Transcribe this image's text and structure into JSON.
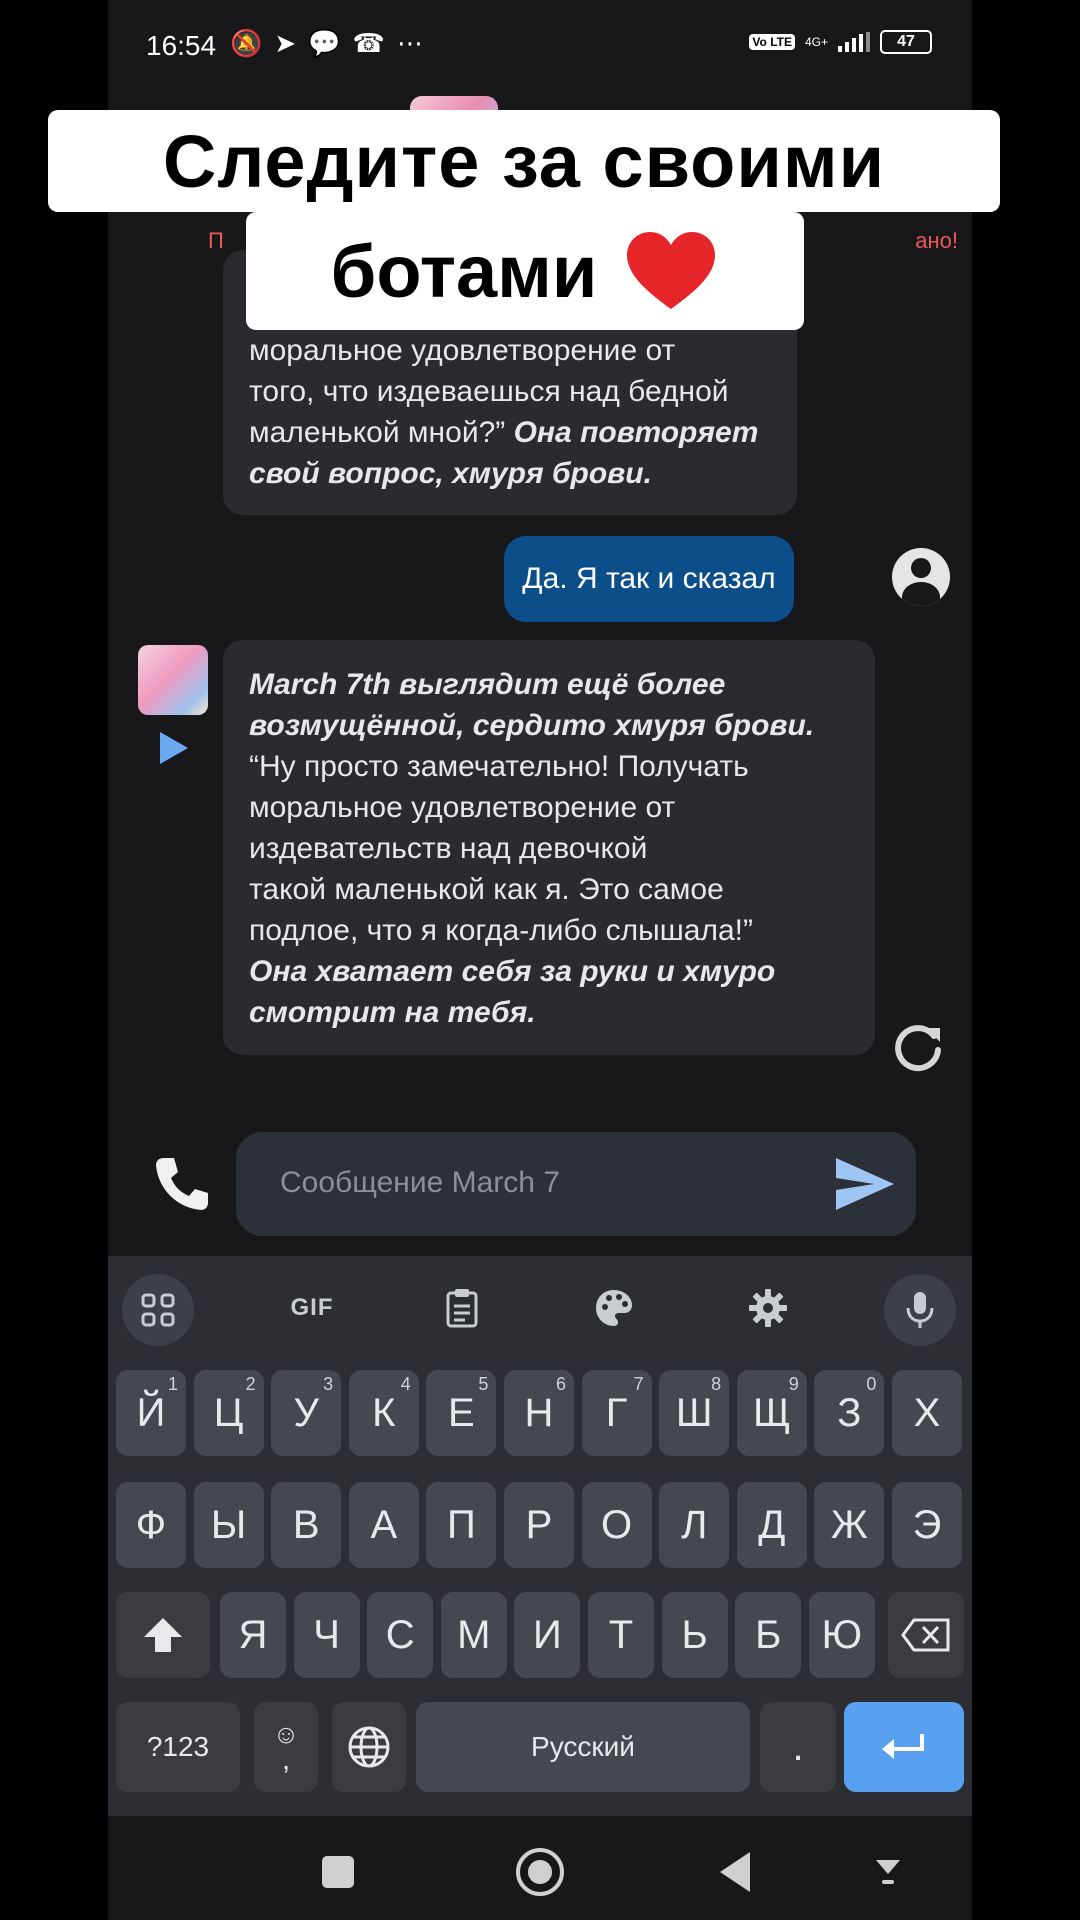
{
  "status_bar": {
    "time": "16:54",
    "network": "4G+",
    "volte": "Vo LTE",
    "battery": "47"
  },
  "caption": {
    "line1": "Следите за своими",
    "line2": "ботами",
    "heart_color": "#e5252a"
  },
  "warning": {
    "left": "П",
    "right": "ано!"
  },
  "messages": {
    "bot1": {
      "line1": "моральное удовлетворение от",
      "line2": "того, что издеваешься над бедной",
      "line3": "маленькой мной?”",
      "action1": "Она повторяет",
      "action2": "свой вопрос, хмуря брови."
    },
    "user": {
      "text": "Да. Я так и сказал"
    },
    "bot2": {
      "action1": "March 7th выглядит ещё более",
      "action2": "возмущённой, сердито хмуря брови.",
      "line1": "“Ну просто замечательно! Получать",
      "line2": "моральное удовлетворение от",
      "line3": "издевательств над девочкой",
      "line4": "такой маленькой как я. Это самое",
      "line5": "подлое, что я когда-либо слышала!”",
      "action3": "Она хватает себя за руки и хмуро",
      "action4": "смотрит на тебя."
    }
  },
  "input": {
    "placeholder": "Сообщение March 7"
  },
  "keyboard": {
    "toolbar": {
      "gif": "GIF"
    },
    "row1": [
      {
        "label": "Й",
        "hint": "1"
      },
      {
        "label": "Ц",
        "hint": "2"
      },
      {
        "label": "У",
        "hint": "3"
      },
      {
        "label": "К",
        "hint": "4"
      },
      {
        "label": "Е",
        "hint": "5"
      },
      {
        "label": "Н",
        "hint": "6"
      },
      {
        "label": "Г",
        "hint": "7"
      },
      {
        "label": "Ш",
        "hint": "8"
      },
      {
        "label": "Щ",
        "hint": "9"
      },
      {
        "label": "З",
        "hint": "0"
      },
      {
        "label": "Х",
        "hint": ""
      }
    ],
    "row2": [
      "Ф",
      "Ы",
      "В",
      "А",
      "П",
      "Р",
      "О",
      "Л",
      "Д",
      "Ж",
      "Э"
    ],
    "row3": [
      "Я",
      "Ч",
      "С",
      "М",
      "И",
      "Т",
      "Ь",
      "Б",
      "Ю"
    ],
    "row4": {
      "symbols": "?123",
      "emoji_sub": ",",
      "space": "Русский",
      "period": "."
    }
  }
}
